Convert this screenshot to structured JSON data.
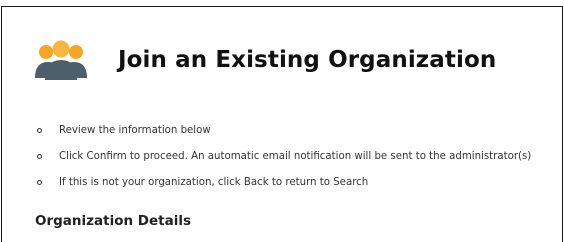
{
  "page": {
    "title": "Join an Existing Organization",
    "header_icon": "people-group-icon",
    "instructions": [
      "Review the information below",
      "Click Confirm to proceed. An automatic email notification will be sent to the administrator(s)",
      "If this is not your organization, click Back to return to Search"
    ],
    "section_heading": "Organization Details"
  },
  "colors": {
    "icon_heads": "#F5A623",
    "icon_bodies": "#4D5F6B",
    "text": "#333333"
  }
}
